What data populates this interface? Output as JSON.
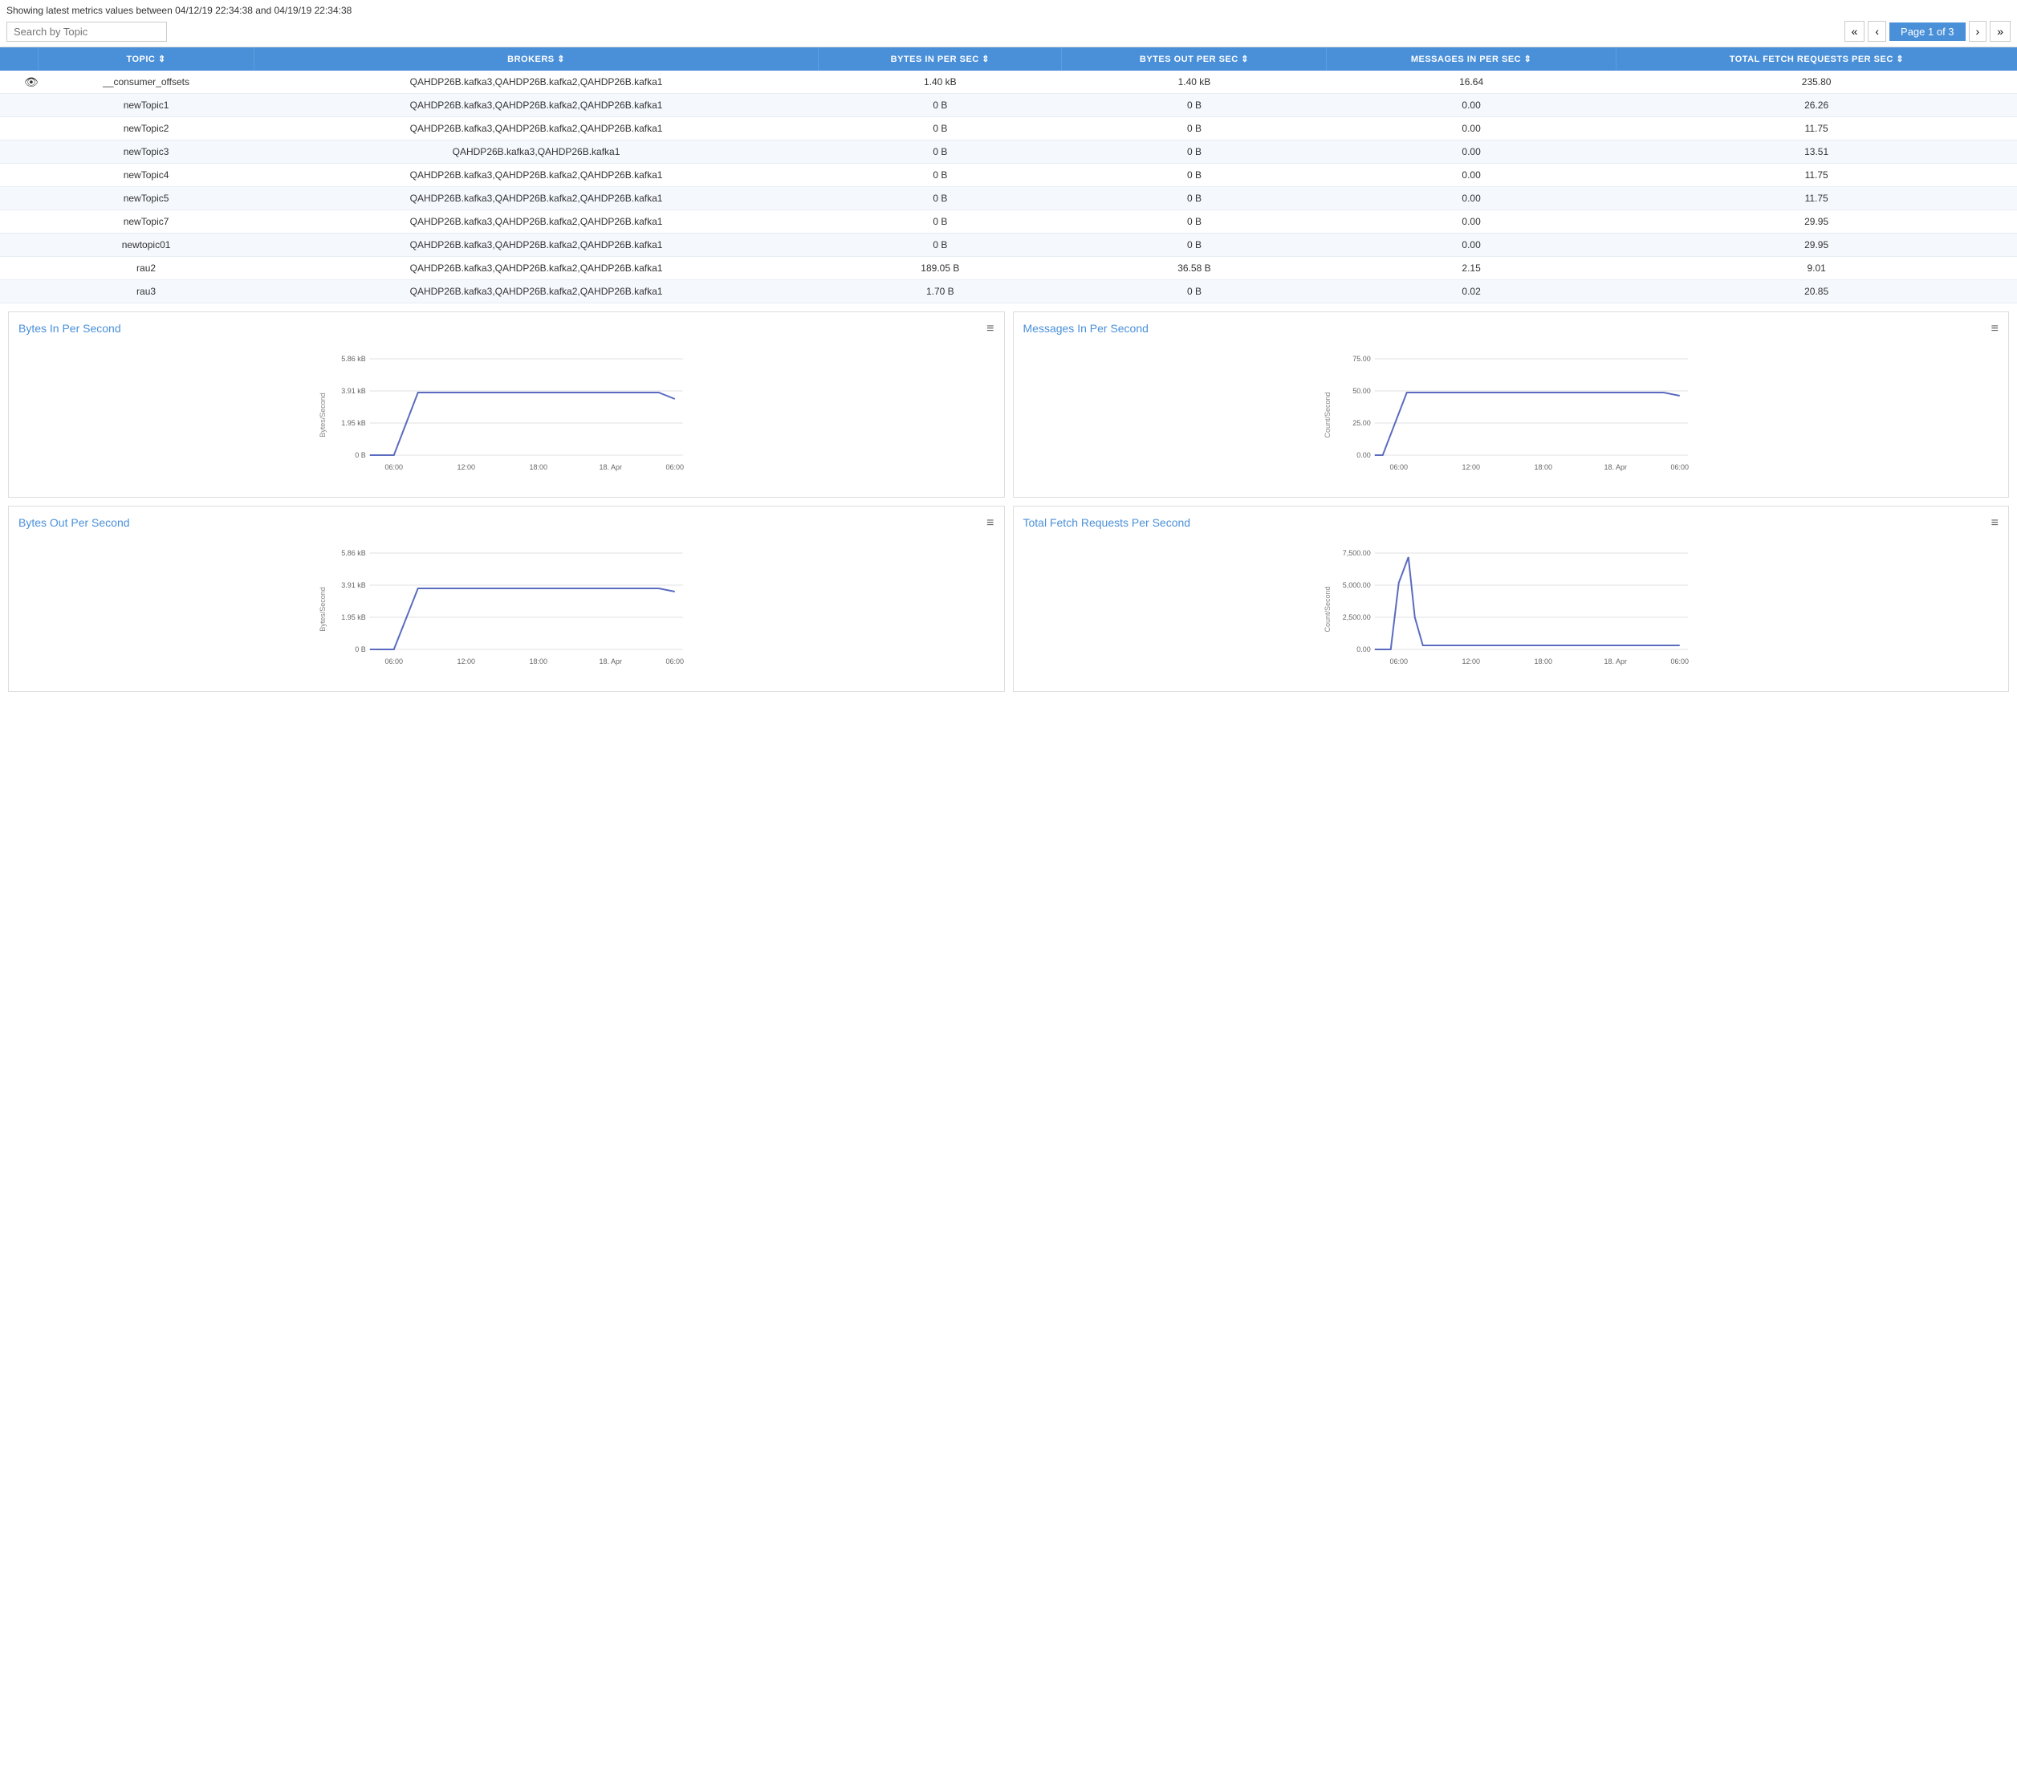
{
  "header": {
    "showing_text": "Showing latest metrics values between 04/12/19 22:34:38 and 04/19/19 22:34:38",
    "search_placeholder": "Search by Topic",
    "page_info": "Page 1 of 3"
  },
  "pagination": {
    "first_label": "«",
    "prev_label": "‹",
    "next_label": "›",
    "last_label": "»"
  },
  "table": {
    "columns": [
      "TOPIC",
      "BROKERS",
      "BYTES IN PER SEC",
      "BYTES OUT PER SEC",
      "MESSAGES IN PER SEC",
      "TOTAL FETCH REQUESTS PER SEC"
    ],
    "rows": [
      {
        "topic": "__consumer_offsets",
        "brokers": "QAHDP26B.kafka3,QAHDP26B.kafka2,QAHDP26B.kafka1",
        "bytes_in": "1.40 kB",
        "bytes_out": "1.40 kB",
        "messages_in": "16.64",
        "total_fetch": "235.80"
      },
      {
        "topic": "newTopic1",
        "brokers": "QAHDP26B.kafka3,QAHDP26B.kafka2,QAHDP26B.kafka1",
        "bytes_in": "0 B",
        "bytes_out": "0 B",
        "messages_in": "0.00",
        "total_fetch": "26.26"
      },
      {
        "topic": "newTopic2",
        "brokers": "QAHDP26B.kafka3,QAHDP26B.kafka2,QAHDP26B.kafka1",
        "bytes_in": "0 B",
        "bytes_out": "0 B",
        "messages_in": "0.00",
        "total_fetch": "11.75"
      },
      {
        "topic": "newTopic3",
        "brokers": "QAHDP26B.kafka3,QAHDP26B.kafka1",
        "bytes_in": "0 B",
        "bytes_out": "0 B",
        "messages_in": "0.00",
        "total_fetch": "13.51"
      },
      {
        "topic": "newTopic4",
        "brokers": "QAHDP26B.kafka3,QAHDP26B.kafka2,QAHDP26B.kafka1",
        "bytes_in": "0 B",
        "bytes_out": "0 B",
        "messages_in": "0.00",
        "total_fetch": "11.75"
      },
      {
        "topic": "newTopic5",
        "brokers": "QAHDP26B.kafka3,QAHDP26B.kafka2,QAHDP26B.kafka1",
        "bytes_in": "0 B",
        "bytes_out": "0 B",
        "messages_in": "0.00",
        "total_fetch": "11.75"
      },
      {
        "topic": "newTopic7",
        "brokers": "QAHDP26B.kafka3,QAHDP26B.kafka2,QAHDP26B.kafka1",
        "bytes_in": "0 B",
        "bytes_out": "0 B",
        "messages_in": "0.00",
        "total_fetch": "29.95"
      },
      {
        "topic": "newtopic01",
        "brokers": "QAHDP26B.kafka3,QAHDP26B.kafka2,QAHDP26B.kafka1",
        "bytes_in": "0 B",
        "bytes_out": "0 B",
        "messages_in": "0.00",
        "total_fetch": "29.95"
      },
      {
        "topic": "rau2",
        "brokers": "QAHDP26B.kafka3,QAHDP26B.kafka2,QAHDP26B.kafka1",
        "bytes_in": "189.05 B",
        "bytes_out": "36.58 B",
        "messages_in": "2.15",
        "total_fetch": "9.01"
      },
      {
        "topic": "rau3",
        "brokers": "QAHDP26B.kafka3,QAHDP26B.kafka2,QAHDP26B.kafka1",
        "bytes_in": "1.70 B",
        "bytes_out": "0 B",
        "messages_in": "0.02",
        "total_fetch": "20.85"
      }
    ]
  },
  "charts": {
    "bytes_in": {
      "title": "Bytes In Per Second",
      "y_label": "Bytes/Second",
      "y_ticks": [
        "5.86 kB",
        "3.91 kB",
        "1.95 kB",
        "0 B"
      ],
      "x_ticks": [
        "06:00",
        "12:00",
        "18:00",
        "18. Apr",
        "06:00"
      ],
      "menu_label": "≡"
    },
    "messages_in": {
      "title": "Messages In Per Second",
      "y_label": "Count/Second",
      "y_ticks": [
        "75.00",
        "50.00",
        "25.00",
        "0.00"
      ],
      "x_ticks": [
        "06:00",
        "12:00",
        "18:00",
        "18. Apr",
        "06:00"
      ],
      "menu_label": "≡"
    },
    "bytes_out": {
      "title": "Bytes Out Per Second",
      "y_label": "Bytes/Second",
      "y_ticks": [
        "5.86 kB",
        "3.91 kB",
        "1.95 kB",
        "0 B"
      ],
      "x_ticks": [
        "06:00",
        "12:00",
        "18:00",
        "18. Apr",
        "06:00"
      ],
      "menu_label": "≡"
    },
    "total_fetch": {
      "title": "Total Fetch Requests Per Second",
      "y_label": "Count/Second",
      "y_ticks": [
        "7,500.00",
        "5,000.00",
        "2,500.00",
        "0.00"
      ],
      "x_ticks": [
        "06:00",
        "12:00",
        "18:00",
        "18. Apr",
        "06:00"
      ],
      "menu_label": "≡"
    }
  }
}
